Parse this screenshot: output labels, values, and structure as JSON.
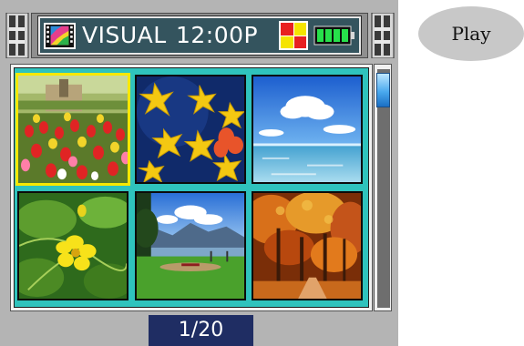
{
  "header": {
    "title": "VISUAL",
    "time": "12:00P",
    "app_icon": "film-image-icon",
    "mode_icon": "mosaic-icon",
    "battery_icon": "battery-full-icon"
  },
  "gallery": {
    "selected_index": 0,
    "thumbnails": [
      {
        "subject": "tulip garden"
      },
      {
        "subject": "yellow flowers on blue background"
      },
      {
        "subject": "sea and sky"
      },
      {
        "subject": "yellow flower with leaves"
      },
      {
        "subject": "lakeside park with mountains"
      },
      {
        "subject": "autumn trees"
      }
    ]
  },
  "pager": {
    "text": "1/20"
  },
  "play_button": {
    "label": "Play"
  },
  "colors": {
    "frame": "#b4b4b4",
    "header": "#34545e",
    "grid_background": "#2fc3bd",
    "selection": "#f8e800",
    "pager": "#1f2d63"
  }
}
